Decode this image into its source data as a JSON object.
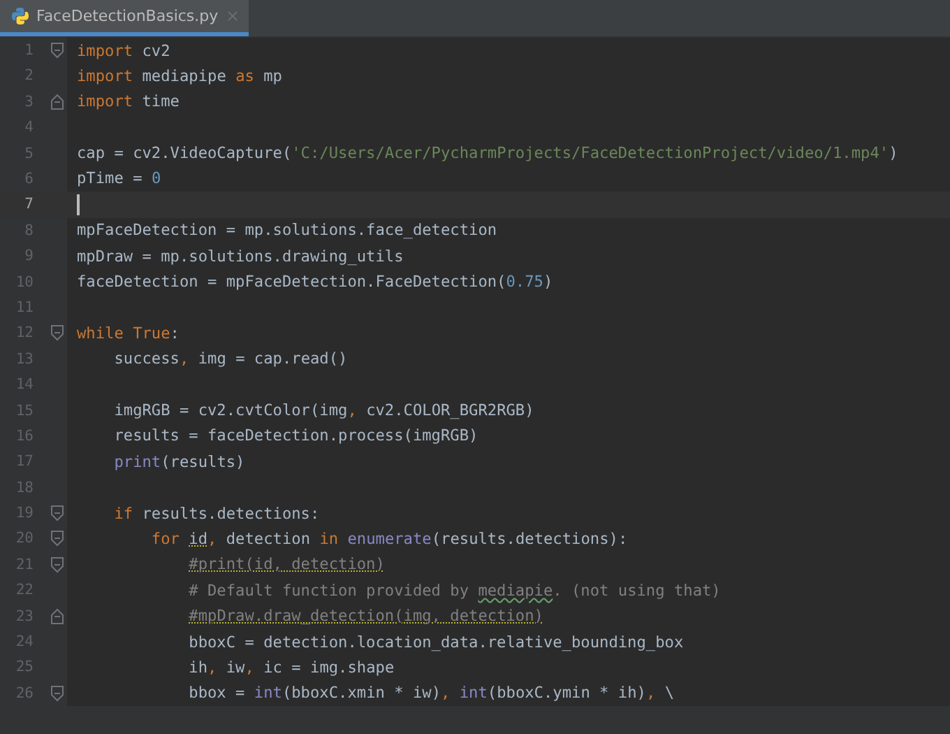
{
  "tabs": [
    {
      "label": "FaceDetectionBasics.py",
      "selected": true
    }
  ],
  "editor": {
    "lines": [
      {
        "n": "1",
        "fold": {
          "kind": "start"
        },
        "current": false,
        "tokens": [
          {
            "kind": "kw",
            "t": "import"
          },
          {
            "kind": "plain",
            "t": " cv2"
          }
        ]
      },
      {
        "n": "2",
        "current": false,
        "tokens": [
          {
            "kind": "kw",
            "t": "import"
          },
          {
            "kind": "plain",
            "t": " mediapipe "
          },
          {
            "kind": "kw",
            "t": "as"
          },
          {
            "kind": "plain",
            "t": " mp"
          }
        ]
      },
      {
        "n": "3",
        "fold": {
          "kind": "end"
        },
        "current": false,
        "tokens": [
          {
            "kind": "kw",
            "t": "import"
          },
          {
            "kind": "plain",
            "t": " time"
          }
        ]
      },
      {
        "n": "4",
        "current": false
      },
      {
        "n": "5",
        "current": false,
        "tokens": [
          {
            "kind": "plain",
            "t": "cap = cv2.VideoCapture("
          },
          {
            "kind": "str",
            "t": "'C:/Users/Acer/PycharmProjects/FaceDetectionProject/video/1.mp4'"
          },
          {
            "kind": "plain",
            "t": ")"
          }
        ]
      },
      {
        "n": "6",
        "current": false,
        "tokens": [
          {
            "kind": "plain",
            "t": "pTime = "
          },
          {
            "kind": "num",
            "t": "0"
          }
        ]
      },
      {
        "n": "7",
        "current": true
      },
      {
        "n": "8",
        "current": false,
        "tokens": [
          {
            "kind": "plain",
            "t": "mpFaceDetection = mp.solutions.face_detection"
          }
        ]
      },
      {
        "n": "9",
        "current": false,
        "tokens": [
          {
            "kind": "plain",
            "t": "mpDraw = mp.solutions.drawing_utils"
          }
        ]
      },
      {
        "n": "10",
        "current": false,
        "tokens": [
          {
            "kind": "plain",
            "t": "faceDetection = mpFaceDetection.FaceDetection("
          },
          {
            "kind": "num",
            "t": "0.75"
          },
          {
            "kind": "plain",
            "t": ")"
          }
        ]
      },
      {
        "n": "11",
        "current": false
      },
      {
        "n": "12",
        "fold": {
          "kind": "start"
        },
        "current": false,
        "tokens": [
          {
            "kind": "kw",
            "t": "while True"
          },
          {
            "kind": "plain",
            "t": ":"
          }
        ]
      },
      {
        "n": "13",
        "current": false,
        "tokens": [
          {
            "kind": "plain",
            "t": "    success"
          },
          {
            "kind": "kw",
            "t": ","
          },
          {
            "kind": "plain",
            "t": " img = cap.read()"
          }
        ]
      },
      {
        "n": "14",
        "current": false
      },
      {
        "n": "15",
        "current": false,
        "tokens": [
          {
            "kind": "plain",
            "t": "    imgRGB = cv2.cvtColor(img"
          },
          {
            "kind": "kw",
            "t": ","
          },
          {
            "kind": "plain",
            "t": " cv2.COLOR_BGR2RGB)"
          }
        ]
      },
      {
        "n": "16",
        "current": false,
        "tokens": [
          {
            "kind": "plain",
            "t": "    results = faceDetection.process(imgRGB)"
          }
        ]
      },
      {
        "n": "17",
        "current": false,
        "tokens": [
          {
            "kind": "builtin",
            "t": "    print"
          },
          {
            "kind": "plain",
            "t": "(results)"
          }
        ]
      },
      {
        "n": "18",
        "current": false
      },
      {
        "n": "19",
        "fold": {
          "kind": "start"
        },
        "current": false,
        "tokens": [
          {
            "kind": "kw",
            "t": "    if"
          },
          {
            "kind": "plain",
            "t": " results.detections:"
          }
        ]
      },
      {
        "n": "20",
        "fold": {
          "kind": "start"
        },
        "current": false,
        "tokens": [
          {
            "kind": "kw",
            "t": "        for "
          },
          {
            "kind": "plain",
            "t": "id",
            "warning_underline": true
          },
          {
            "kind": "kw",
            "t": ","
          },
          {
            "kind": "plain",
            "t": " detection "
          },
          {
            "kind": "kw",
            "t": "in "
          },
          {
            "kind": "builtin",
            "t": "enumerate"
          },
          {
            "kind": "plain",
            "t": "(results.detections):"
          }
        ]
      },
      {
        "n": "21",
        "fold": {
          "kind": "start"
        },
        "current": false,
        "tokens": [
          {
            "kind": "comment",
            "t": "            #print(id, detection)",
            "warning_underline": true
          }
        ]
      },
      {
        "n": "22",
        "current": false,
        "tokens": [
          {
            "kind": "comment",
            "t": "            # Default function provided by "
          },
          {
            "kind": "comment",
            "t": "mediapie",
            "spelling_underline": true
          },
          {
            "kind": "comment",
            "t": ". (not using that)"
          }
        ]
      },
      {
        "n": "23",
        "fold": {
          "kind": "end"
        },
        "current": false,
        "tokens": [
          {
            "kind": "comment",
            "t": "            #mpDraw.draw_detection(img, detection)",
            "warning_underline": true
          }
        ]
      },
      {
        "n": "24",
        "current": false,
        "tokens": [
          {
            "kind": "plain",
            "t": "            bboxC = detection.location_data.relative_bounding_box"
          }
        ]
      },
      {
        "n": "25",
        "current": false,
        "tokens": [
          {
            "kind": "plain",
            "t": "            ih"
          },
          {
            "kind": "kw",
            "t": ","
          },
          {
            "kind": "plain",
            "t": " iw"
          },
          {
            "kind": "kw",
            "t": ","
          },
          {
            "kind": "plain",
            "t": " ic = img.shape"
          }
        ]
      },
      {
        "n": "26",
        "fold": {
          "kind": "start"
        },
        "current": false,
        "tokens": [
          {
            "kind": "plain",
            "t": "            bbox = "
          },
          {
            "kind": "builtin",
            "t": "int"
          },
          {
            "kind": "plain",
            "t": "(bboxC.xmin * iw)"
          },
          {
            "kind": "kw",
            "t": ", "
          },
          {
            "kind": "builtin",
            "t": "int"
          },
          {
            "kind": "plain",
            "t": "(bboxC.ymin * ih)"
          },
          {
            "kind": "kw",
            "t": ","
          },
          {
            "kind": "plain",
            "t": " \\"
          }
        ]
      }
    ]
  }
}
